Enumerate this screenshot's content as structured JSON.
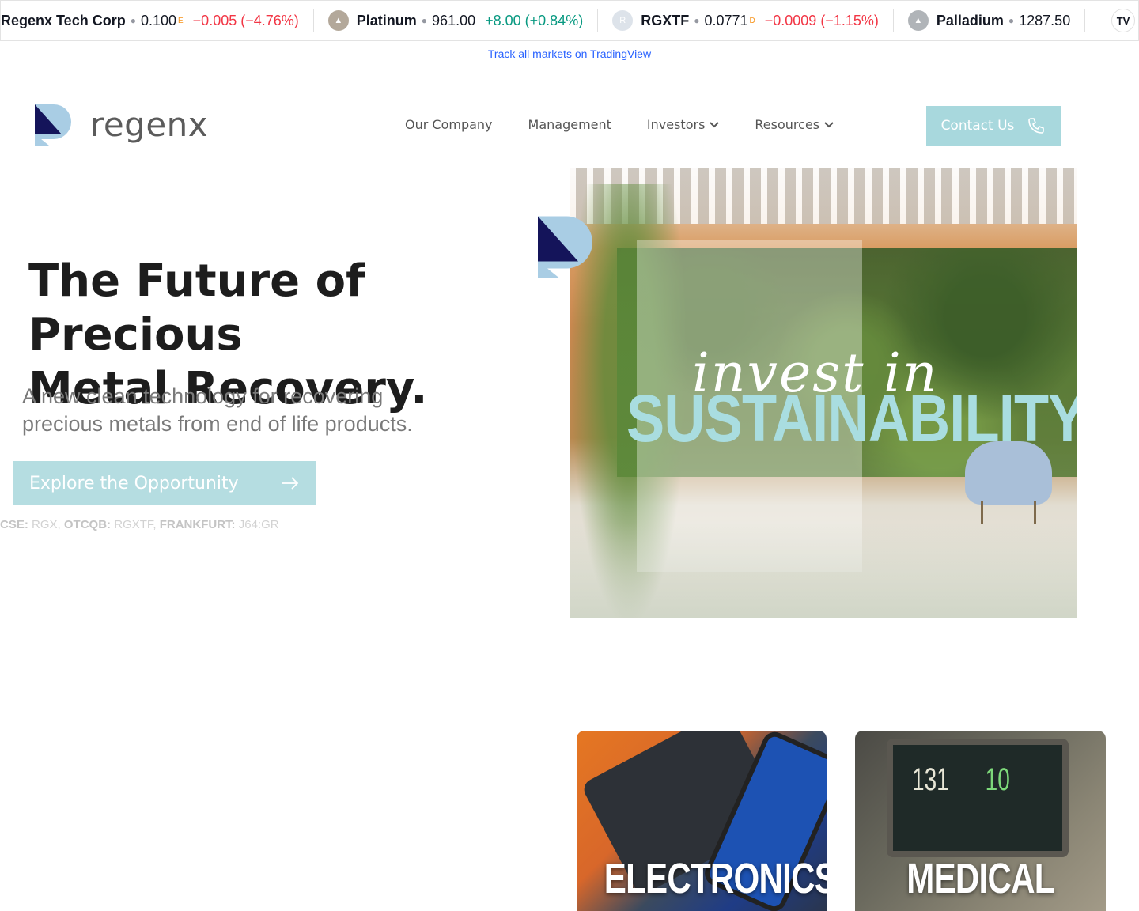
{
  "ticker": {
    "items": [
      {
        "name": "Regenx Tech Corp",
        "price": "0.100",
        "sup": "E",
        "change": "−0.005 (−4.76%)",
        "direction": "neg",
        "icon": "",
        "icon_color": "#ffffff"
      },
      {
        "name": "Platinum",
        "price": "961.00",
        "sup": "",
        "change": "+8.00 (+0.84%)",
        "direction": "pos",
        "icon": "",
        "icon_color": "#b3a89a"
      },
      {
        "name": "RGXTF",
        "price": "0.0771",
        "sup": "D",
        "change": "−0.0009 (−1.15%)",
        "direction": "neg",
        "icon": "R",
        "icon_color": "#dde3ea"
      },
      {
        "name": "Palladium",
        "price": "1287.50",
        "sup": "",
        "change": "",
        "direction": "pos",
        "icon": "",
        "icon_color": "#b0b4b8"
      }
    ],
    "tv_logo": "TV",
    "track_link": "Track all markets on TradingView"
  },
  "brand": {
    "name": "regenx",
    "logo_dark": "#14145a",
    "logo_light": "#a9cde4"
  },
  "nav": {
    "items": [
      {
        "label": "Our Company",
        "dropdown": false
      },
      {
        "label": "Management",
        "dropdown": false
      },
      {
        "label": "Investors",
        "dropdown": true
      },
      {
        "label": "Resources",
        "dropdown": true
      }
    ],
    "contact_label": "Contact Us",
    "contact_icon": "phone-icon"
  },
  "hero": {
    "title_line1": "The Future of Precious",
    "title_line2": "Metal Recovery.",
    "subtitle_line1": "A new clean technology for recovering",
    "subtitle_line2": "precious metals from end of life products.",
    "cta_label": "Explore the Opportunity",
    "cta_icon": "arrow-right-icon",
    "listing": [
      {
        "exchange": "CSE:",
        "symbol": "RGX,"
      },
      {
        "exchange": "OTCQB:",
        "symbol": "RGXTF,"
      },
      {
        "exchange": "FRANKFURT:",
        "symbol": "J64:GR"
      }
    ],
    "image_script_text": "invest in",
    "image_headline": "SUSTAINABILITY"
  },
  "cards": [
    {
      "label": "ELECTRONICS"
    },
    {
      "label": "MEDICAL",
      "monitor_a": "131",
      "monitor_b": "10"
    }
  ],
  "colors": {
    "accent": "#a8d8dd",
    "negative": "#f23645",
    "positive": "#089981"
  }
}
